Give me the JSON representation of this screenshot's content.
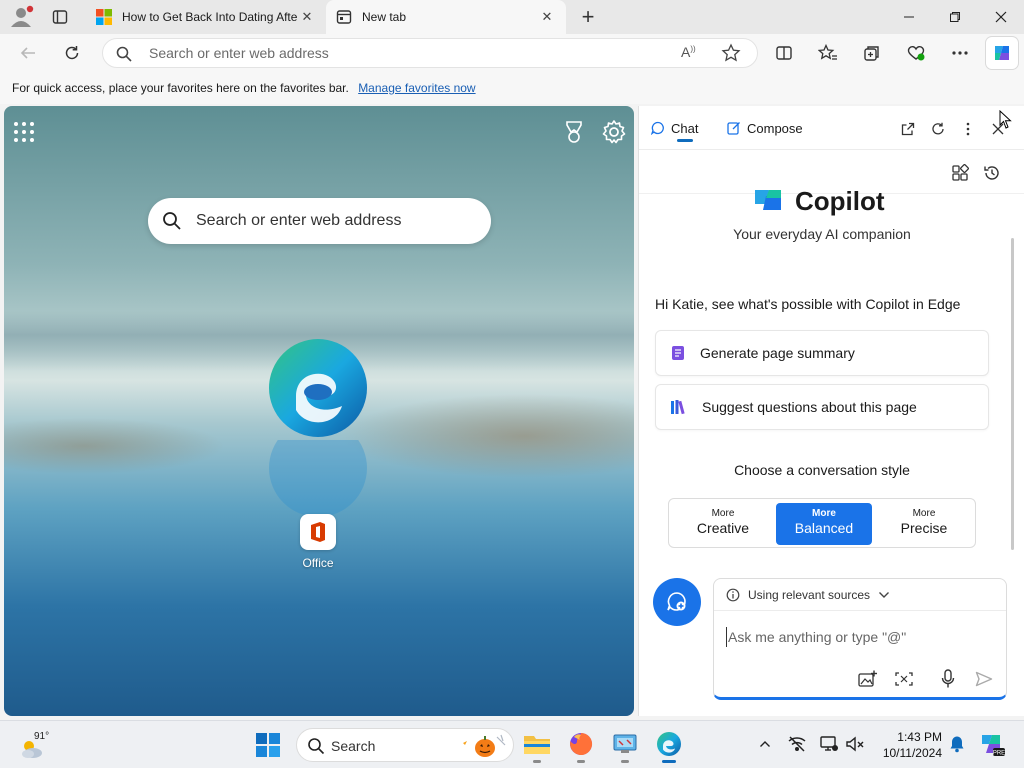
{
  "tabs": [
    {
      "title": "How to Get Back Into Dating Afte",
      "active": false
    },
    {
      "title": "New tab",
      "active": true
    }
  ],
  "toolbar": {
    "address_placeholder": "Search or enter web address",
    "read_aloud_glyph": "A"
  },
  "favbar": {
    "text": "For quick access, place your favorites here on the favorites bar.",
    "link": "Manage favorites now"
  },
  "ntp": {
    "search_placeholder": "Search or enter web address",
    "tile_label": "Office"
  },
  "copilot": {
    "tab_chat": "Chat",
    "tab_compose": "Compose",
    "brand": "Copilot",
    "tagline": "Your everyday AI companion",
    "greeting": "Hi Katie, see what's possible with Copilot in Edge",
    "suggestions": [
      "Generate page summary",
      "Suggest questions about this page"
    ],
    "style_heading": "Choose a conversation style",
    "styles": [
      {
        "more": "More",
        "name": "Creative",
        "selected": false
      },
      {
        "more": "More",
        "name": "Balanced",
        "selected": true
      },
      {
        "more": "More",
        "name": "Precise",
        "selected": false
      }
    ],
    "sources_label": "Using relevant sources",
    "input_placeholder": "Ask me anything or type \"@\""
  },
  "taskbar": {
    "weather_temp": "91°",
    "search_placeholder": "Search",
    "time": "1:43 PM",
    "date": "10/11/2024"
  },
  "colors": {
    "accent": "#1a73e8",
    "link": "#1a5fb4"
  }
}
